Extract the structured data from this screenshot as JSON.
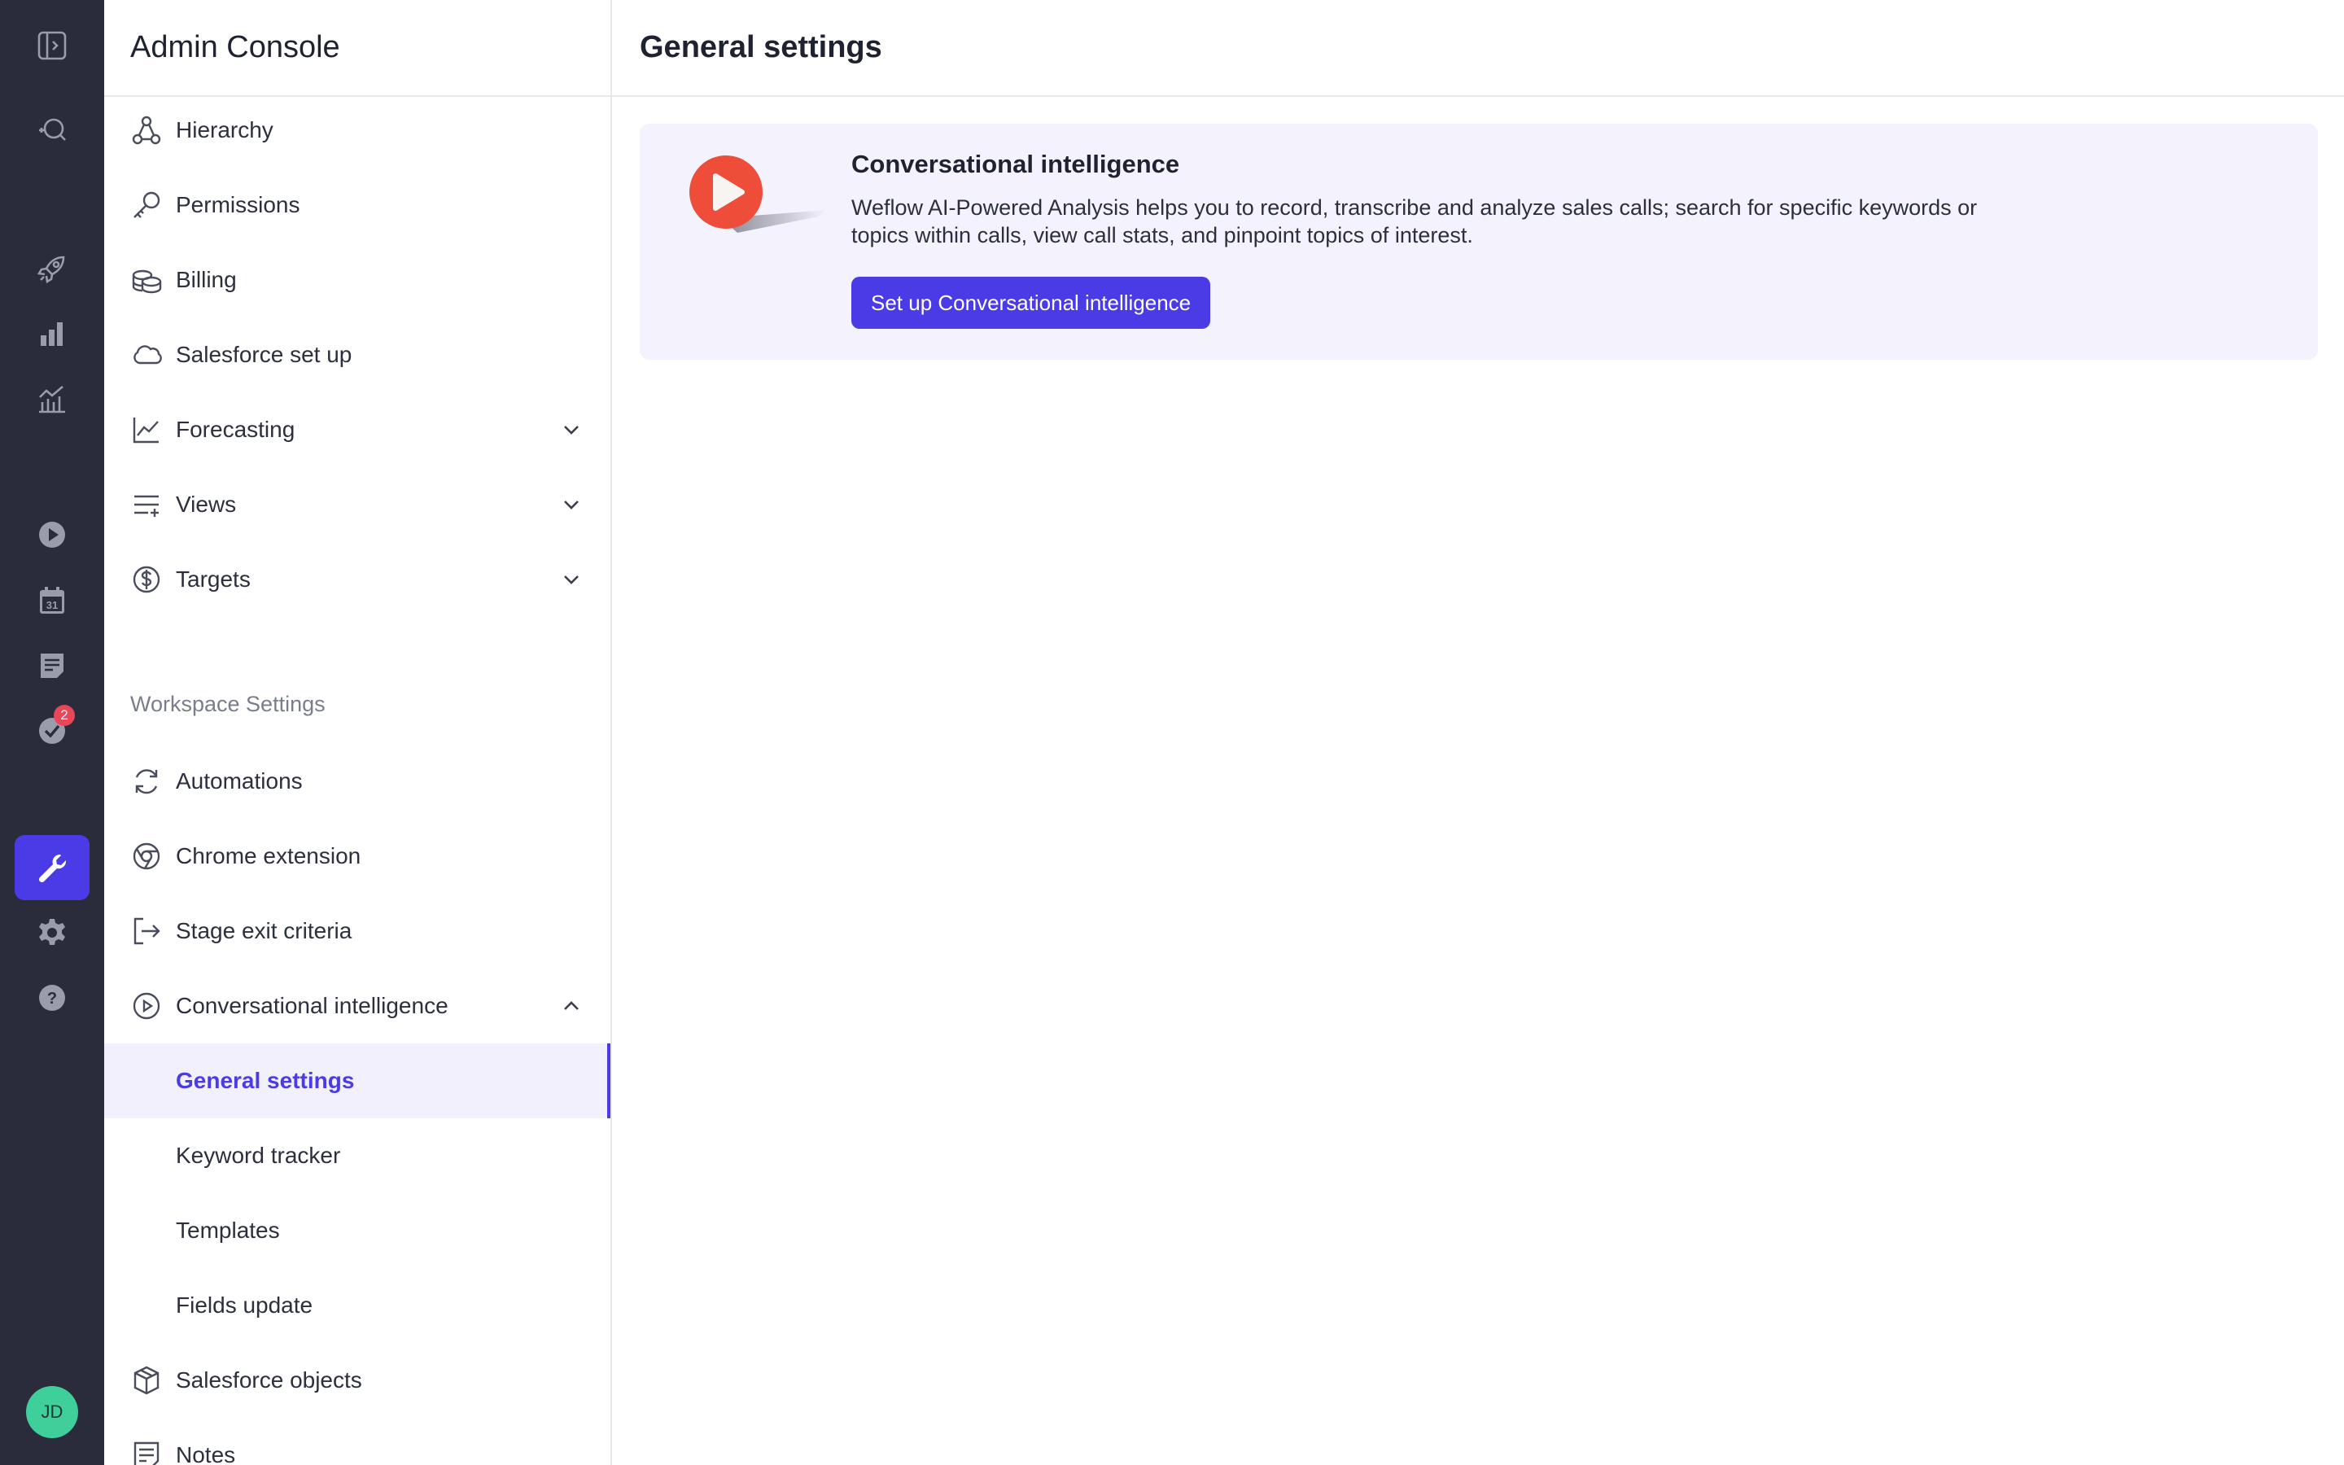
{
  "rail": {
    "icons": [
      "sidebar-toggle-icon",
      "search-chat-icon",
      "rocket-icon",
      "bar-chart-icon",
      "analytics-icon",
      "play-icon",
      "calendar-icon",
      "notes-icon",
      "tasks-icon",
      "wrench-icon",
      "gear-icon",
      "help-icon"
    ],
    "calendar_day": "31",
    "tasks_badge": "2",
    "avatar_initials": "JD"
  },
  "menu": {
    "title": "Admin Console",
    "items": [
      {
        "label": "Hierarchy"
      },
      {
        "label": "Permissions"
      },
      {
        "label": "Billing"
      },
      {
        "label": "Salesforce set up"
      },
      {
        "label": "Forecasting"
      },
      {
        "label": "Views"
      },
      {
        "label": "Targets"
      }
    ],
    "section_label": "Workspace Settings",
    "workspace_items": [
      {
        "label": "Automations"
      },
      {
        "label": "Chrome extension"
      },
      {
        "label": "Stage exit criteria"
      },
      {
        "label": "Conversational intelligence"
      }
    ],
    "sub_items": [
      {
        "label": "General settings"
      },
      {
        "label": "Keyword tracker"
      },
      {
        "label": "Templates"
      },
      {
        "label": "Fields update"
      }
    ],
    "bottom_items": [
      {
        "label": "Salesforce objects"
      },
      {
        "label": "Notes"
      }
    ]
  },
  "main": {
    "title": "General settings",
    "card": {
      "title": "Conversational intelligence",
      "description": "Weflow AI-Powered Analysis helps you to record, transcribe and analyze sales calls; search for specific keywords or topics within calls, view call stats, and pinpoint topics of interest.",
      "button_label": "Set up Conversational intelligence"
    }
  },
  "colors": {
    "rail_bg": "#2b2c3b",
    "accent": "#4a3be6",
    "card_bg": "#f3f2fd",
    "logo_red": "#ee4d3a",
    "badge_red": "#e8475a",
    "avatar_green": "#3fcf9a"
  }
}
